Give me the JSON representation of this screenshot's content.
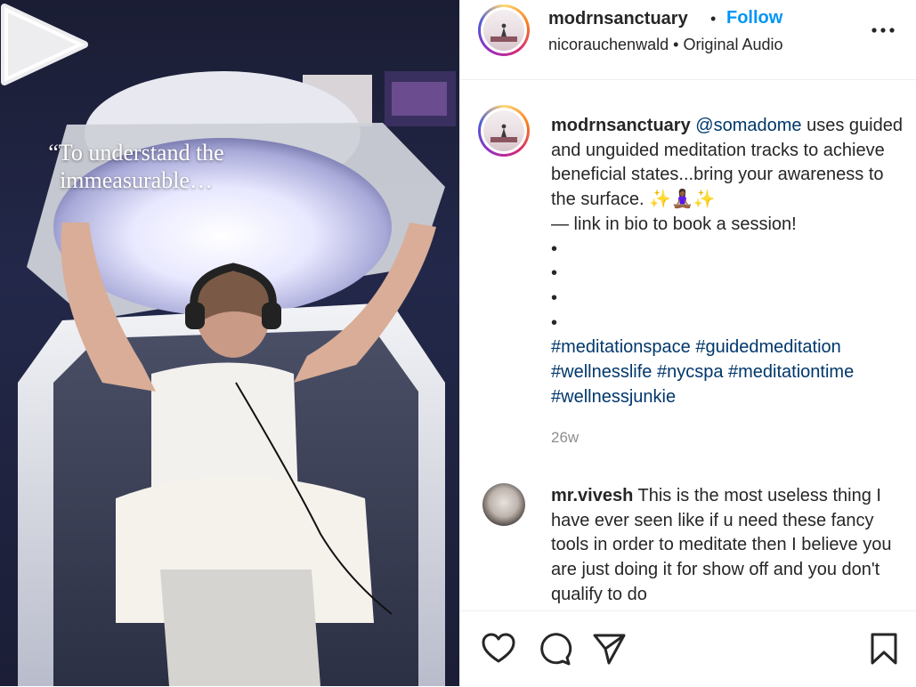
{
  "video": {
    "overlay_text": "“To understand the immeasurable…",
    "play_icon": "play-icon"
  },
  "header": {
    "username": "modrnsanctuary",
    "separator": "•",
    "follow_label": "Follow",
    "audio_user": "nicorauchenwald",
    "audio_separator": "•",
    "audio_label": "Original Audio",
    "more_icon": "more-options-icon"
  },
  "caption": {
    "username": "modrnsanctuary",
    "mention": "@somadome",
    "text_1": " uses guided and unguided meditation tracks to achieve beneficial states...bring your awareness to the surface. ✨🧘🏾‍♀️✨",
    "text_2": "— link in bio to book a session!",
    "bullets": [
      "•",
      "•",
      "•",
      "•"
    ],
    "hashtags": [
      "#meditationspace",
      "#guidedmeditation",
      "#wellnesslife",
      "#nycspa",
      "#meditationtime",
      "#wellnessjunkie"
    ],
    "time": "26w"
  },
  "comment": {
    "username": "mr.vivesh",
    "text": " This is the most useless thing I have ever seen like if u need these fancy tools in order to meditate then I believe you are just doing it for show off and you don't qualify to do"
  },
  "actions": {
    "like_icon": "heart-icon",
    "comment_icon": "comment-icon",
    "share_icon": "share-icon",
    "save_icon": "bookmark-icon"
  },
  "colors": {
    "link_blue": "#0095f6",
    "hashtag_blue": "#00376b",
    "secondary_text": "#8e8e8e"
  }
}
